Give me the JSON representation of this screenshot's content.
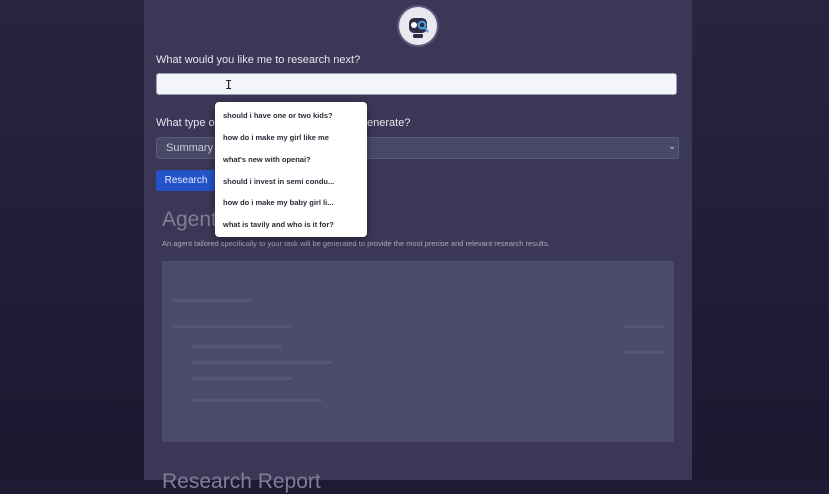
{
  "form": {
    "question_label": "What would you like me to research next?",
    "question_value": "",
    "cursor_glyph": "I",
    "report_type_label_left": "What type o",
    "report_type_label_right": "enerate?",
    "report_type_selected": "Summary",
    "research_button": "Research"
  },
  "suggestions": [
    "should i have one or two kids?",
    "how do i make my girl like me",
    "what's new with openai?",
    "should i invest in semi condu...",
    "how do i make my baby girl li...",
    "what is tavily and who is it for?"
  ],
  "agent_section": {
    "heading": "Agent",
    "description": "An agent tailored specifically to your task will be generated to provide the most precise and relevant research results."
  },
  "report_section": {
    "heading": "Research Report"
  },
  "icons": {
    "logo": "robot-detective-logo",
    "select_chevron": "chevron-down-icon"
  },
  "colors": {
    "button": "#2453c7",
    "panel": "#3a3856",
    "backdrop": "#1d1b33"
  }
}
